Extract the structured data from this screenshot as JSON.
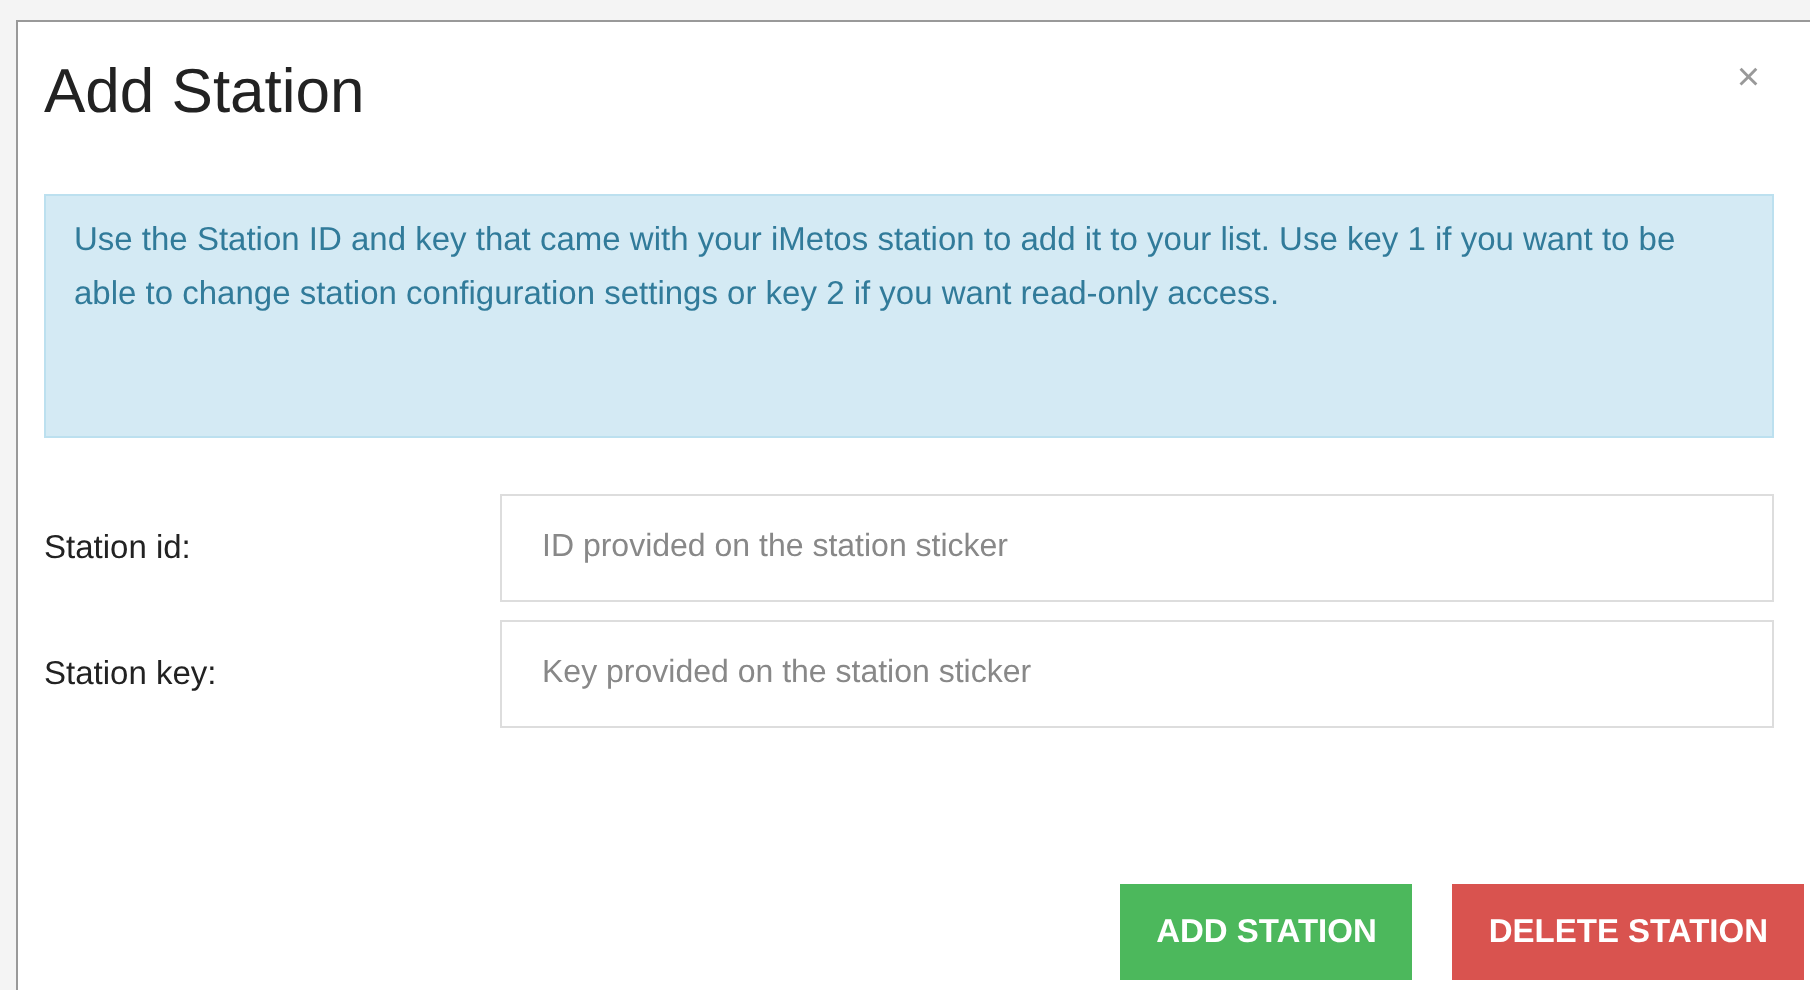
{
  "dialog": {
    "title": "Add Station",
    "close": "×"
  },
  "info": "Use the Station ID and key that came with your iMetos station to add it to your list. Use key 1 if you want to be able to change station configuration settings or key 2 if you want read-only access.",
  "fields": [
    {
      "label": "Station id:",
      "placeholder": "ID provided on the station sticker"
    },
    {
      "label": "Station key:",
      "placeholder": "Key provided on the station sticker"
    }
  ],
  "buttons": [
    {
      "kind": "add",
      "label": "ADD STATION"
    },
    {
      "kind": "delete",
      "label": "DELETE STATION"
    }
  ]
}
